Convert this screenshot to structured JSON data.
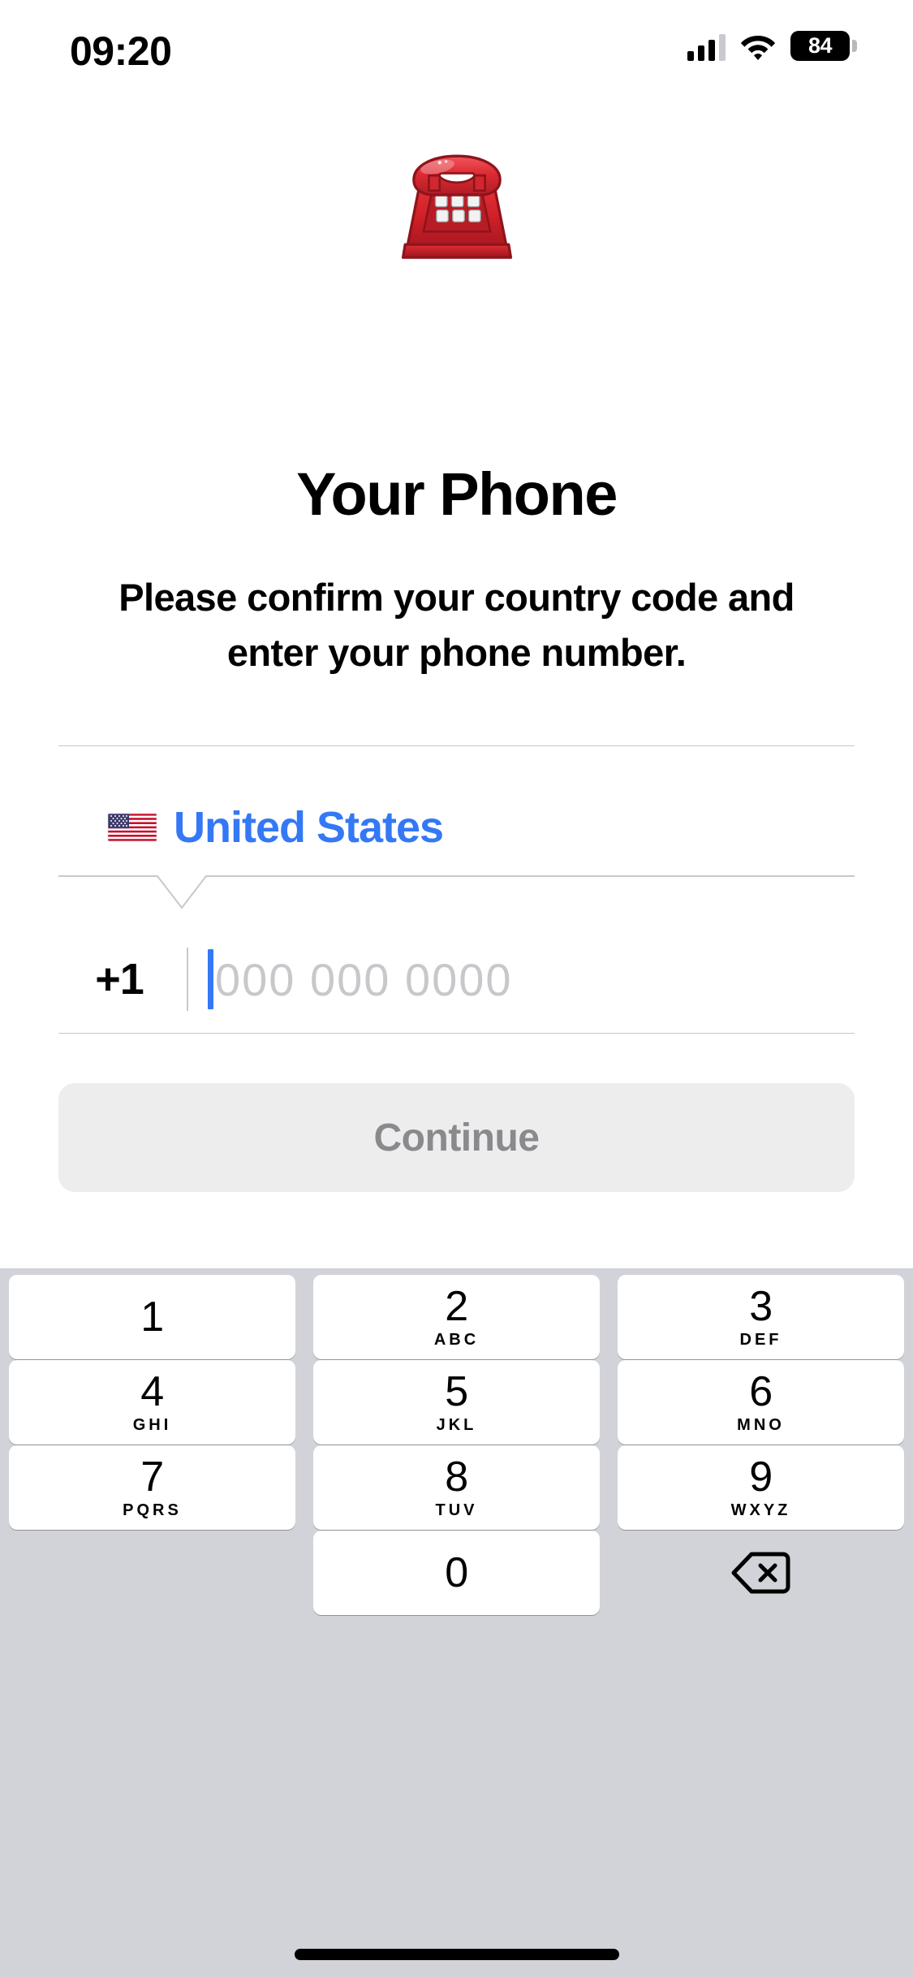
{
  "status_bar": {
    "time": "09:20",
    "battery_level": "84",
    "signal_icon": "cellular-signal-icon",
    "wifi_icon": "wifi-icon",
    "battery_icon": "battery-icon"
  },
  "hero": {
    "emoji": "☎️",
    "emoji_name": "telephone-emoji",
    "title": "Your Phone",
    "subtitle": "Please confirm your country code and enter your phone number."
  },
  "form": {
    "country_flag": "🇺🇸",
    "country_flag_name": "us-flag-icon",
    "country_name": "United States",
    "country_accent_color": "#3478F6",
    "country_code": "+1",
    "phone_placeholder": "000 000 0000",
    "phone_value": "",
    "caret_color": "#3478F6",
    "divider_color": "#C8C8CC"
  },
  "continue_button": {
    "label": "Continue",
    "enabled": false,
    "background_color": "#EDEDED",
    "text_color": "#8A8A8E"
  },
  "keyboard": {
    "background_color": "#D1D3D9",
    "key_color": "#FFFFFF",
    "rows": [
      [
        {
          "digit": "1",
          "letters": ""
        },
        {
          "digit": "2",
          "letters": "ABC"
        },
        {
          "digit": "3",
          "letters": "DEF"
        }
      ],
      [
        {
          "digit": "4",
          "letters": "GHI"
        },
        {
          "digit": "5",
          "letters": "JKL"
        },
        {
          "digit": "6",
          "letters": "MNO"
        }
      ],
      [
        {
          "digit": "7",
          "letters": "PQRS"
        },
        {
          "digit": "8",
          "letters": "TUV"
        },
        {
          "digit": "9",
          "letters": "WXYZ"
        }
      ],
      [
        {
          "digit": "",
          "letters": ""
        },
        {
          "digit": "0",
          "letters": ""
        },
        {
          "digit": "",
          "letters": "",
          "icon": "backspace-icon"
        }
      ]
    ]
  }
}
